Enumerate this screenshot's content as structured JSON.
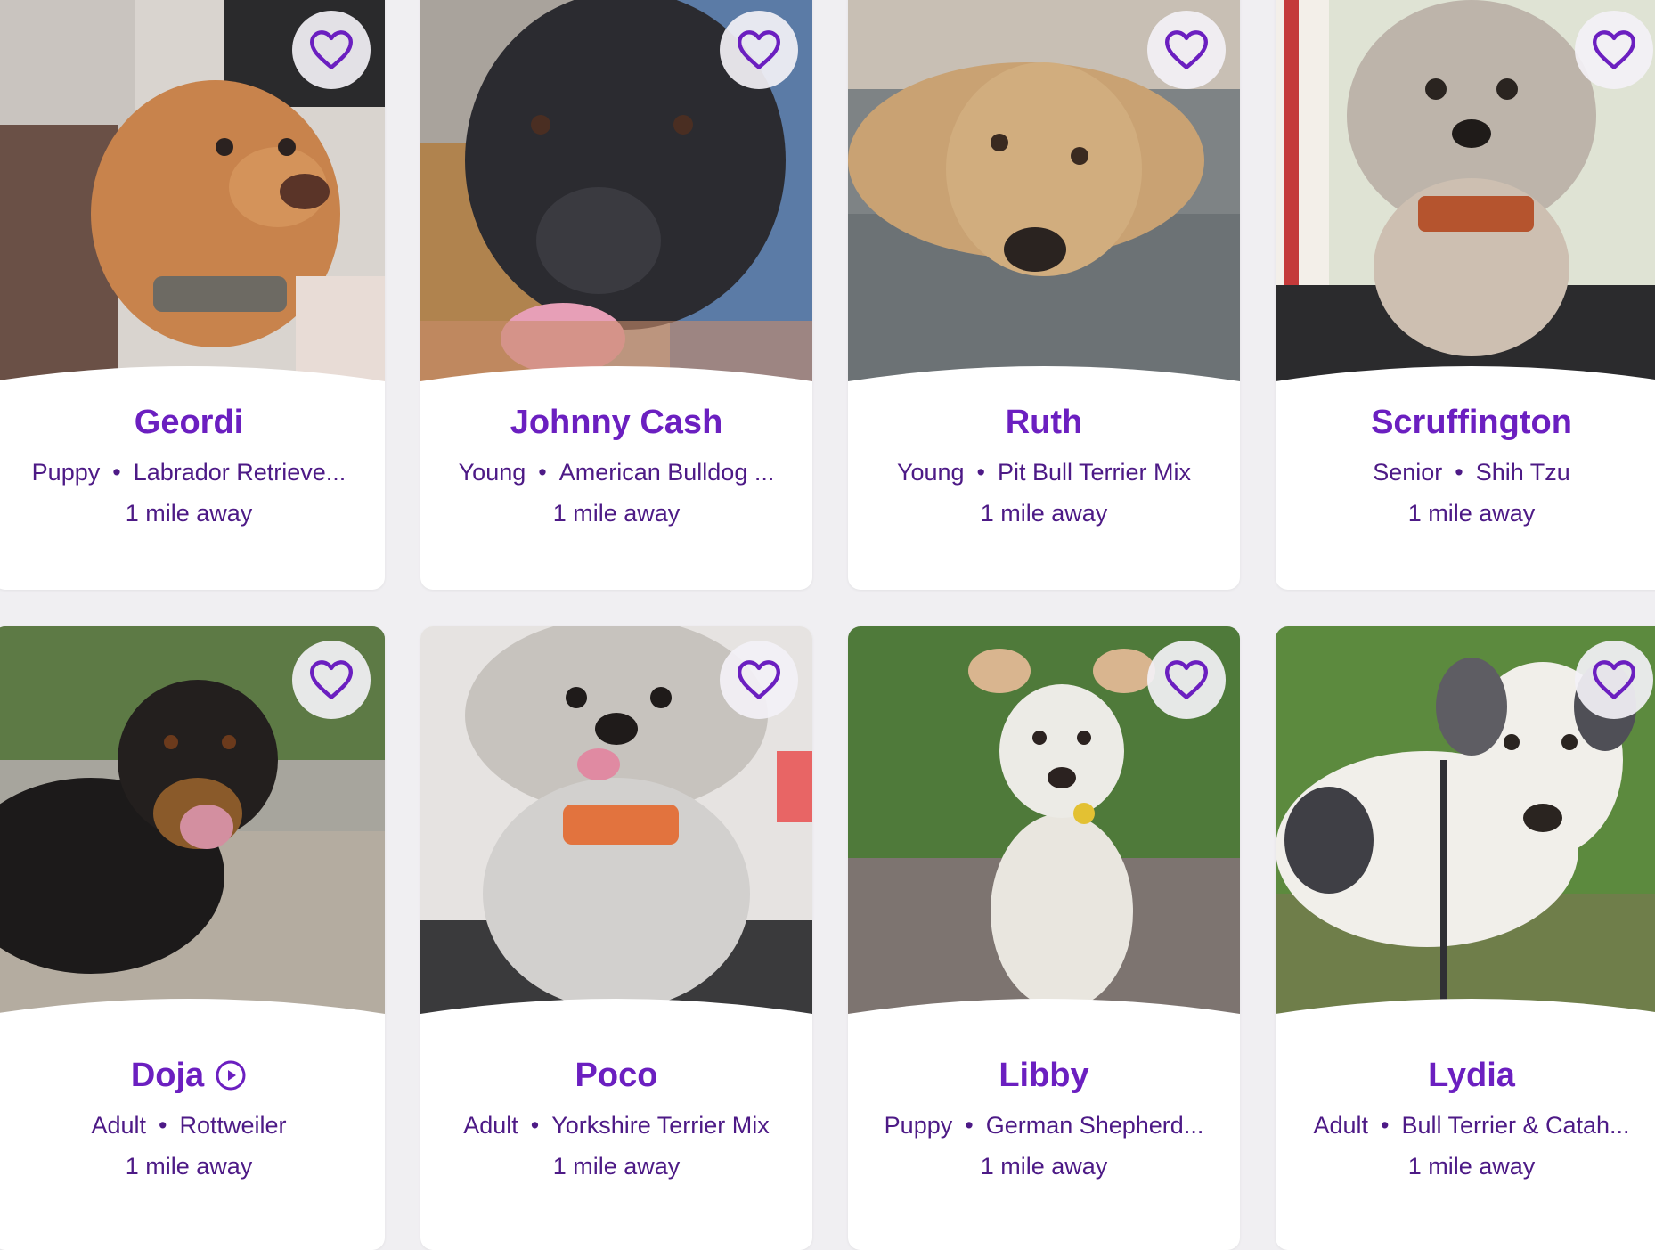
{
  "pets": [
    {
      "name": "Geordi",
      "age": "Puppy",
      "separator": "•",
      "breed": "Labrador Retrieve...",
      "distance": "1 mile away",
      "has_video": false
    },
    {
      "name": "Johnny Cash",
      "age": "Young",
      "separator": "•",
      "breed": "American Bulldog ...",
      "distance": "1 mile away",
      "has_video": false
    },
    {
      "name": "Ruth",
      "age": "Young",
      "separator": "•",
      "breed": "Pit Bull Terrier Mix",
      "distance": "1 mile away",
      "has_video": false
    },
    {
      "name": "Scruffington",
      "age": "Senior",
      "separator": "•",
      "breed": "Shih Tzu",
      "distance": "1 mile away",
      "has_video": false
    },
    {
      "name": "Doja",
      "age": "Adult",
      "separator": "•",
      "breed": "Rottweiler",
      "distance": "1 mile away",
      "has_video": true
    },
    {
      "name": "Poco",
      "age": "Adult",
      "separator": "•",
      "breed": "Yorkshire Terrier Mix",
      "distance": "1 mile away",
      "has_video": false
    },
    {
      "name": "Libby",
      "age": "Puppy",
      "separator": "•",
      "breed": "German Shepherd...",
      "distance": "1 mile away",
      "has_video": false
    },
    {
      "name": "Lydia",
      "age": "Adult",
      "separator": "•",
      "breed": "Bull Terrier & Catah...",
      "distance": "1 mile away",
      "has_video": false
    }
  ],
  "colors": {
    "accent": "#6b1fc0",
    "text": "#4d1a86",
    "background": "#f0eff2",
    "card": "#ffffff",
    "fav_button_bg": "#f3f1f6"
  },
  "icons": {
    "favorite": "heart-outline-icon",
    "video": "play-circle-icon"
  }
}
